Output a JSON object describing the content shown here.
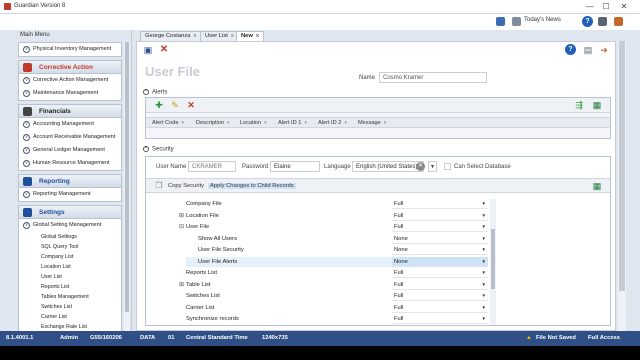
{
  "window": {
    "title": "Guardian Version 8",
    "minimize": "—",
    "maximize": "☐",
    "close": "✕"
  },
  "topbar": {
    "todays_news": "Today's News",
    "help": "?"
  },
  "main_menu": {
    "title": "Main Menu",
    "sections": [
      {
        "label": "",
        "icon": "inventory-icon",
        "items": [
          {
            "label": "Physical Inventory Management"
          }
        ]
      },
      {
        "label": "Corrective Action",
        "color": "#c0392b",
        "icon": "corrective-action-icon",
        "items": [
          {
            "label": "Corrective Action Management"
          },
          {
            "label": "Maintenance Management"
          }
        ]
      },
      {
        "label": "Financials",
        "color": "#222222",
        "icon": "financials-icon",
        "items": [
          {
            "label": "Accounting Management"
          },
          {
            "label": "Account Receivable Management"
          },
          {
            "label": "General Ledger Management"
          },
          {
            "label": "Human Resource Management"
          }
        ]
      },
      {
        "label": "Reporting",
        "color": "#1f4e9c",
        "icon": "reporting-icon",
        "items": [
          {
            "label": "Reporting Management"
          }
        ]
      },
      {
        "label": "Settings",
        "color": "#1f4e9c",
        "icon": "settings-icon",
        "items": [
          {
            "label": "Global Setting Management"
          }
        ],
        "subitems": [
          "Global Settings",
          "SQL Query Tool",
          "Company List",
          "Location List",
          "User List",
          "Reports List",
          "Tables Management",
          "Switches List",
          "Carrier List",
          "Exchange Rate List",
          "Synchronize record"
        ]
      }
    ]
  },
  "tabs": [
    {
      "label": "George Costanza",
      "close": "x"
    },
    {
      "label": "User List",
      "close": "x"
    },
    {
      "label": "New",
      "close": "x",
      "active": true
    }
  ],
  "content": {
    "page_title": "User File",
    "name_label": "Name",
    "name_value": "Cosmo Kramer",
    "alerts": {
      "header": "Alerts",
      "columns": [
        "Alert Code",
        "Description",
        "Location",
        "Alert ID 1",
        "Alert ID 2",
        "Message"
      ]
    },
    "security": {
      "header": "Security",
      "user_name_label": "User Name",
      "user_name_value": "CKRAMER",
      "password_label": "Password",
      "password_value": "Elaine",
      "language_label": "Language",
      "language_value": "English (United States)",
      "can_select_db_label": "Can Select Database",
      "copy_security": "Copy Security",
      "apply_changes": "Apply Changes to Child Records",
      "rows": [
        {
          "name": "Company File",
          "level": 0,
          "expander": "",
          "value": "Full"
        },
        {
          "name": "Location File",
          "level": 0,
          "expander": "⊞",
          "value": "Full"
        },
        {
          "name": "User File",
          "level": 0,
          "expander": "⊟",
          "value": "Full"
        },
        {
          "name": "Show All Users",
          "level": 1,
          "expander": "",
          "value": "None"
        },
        {
          "name": "User File Security",
          "level": 1,
          "expander": "",
          "value": "None"
        },
        {
          "name": "User File Alerts",
          "level": 1,
          "expander": "",
          "value": "None",
          "selected": true
        },
        {
          "name": "Reports List",
          "level": 0,
          "expander": "",
          "value": "Full"
        },
        {
          "name": "Table List",
          "level": 0,
          "expander": "⊞",
          "value": "Full"
        },
        {
          "name": "Switches List",
          "level": 0,
          "expander": "",
          "value": "Full"
        },
        {
          "name": "Carrier List",
          "level": 0,
          "expander": "",
          "value": "Full"
        },
        {
          "name": "Synchronize records",
          "level": 0,
          "expander": "",
          "value": "Full"
        }
      ]
    }
  },
  "statusbar": {
    "version": "8.1.4001.1",
    "user": "Admin",
    "server": "G55/160206",
    "db": "DATA",
    "company": "01",
    "timezone": "Central Standard Time",
    "resolution": "1240x735",
    "file_status": "File Not Saved",
    "access": "Full Access"
  },
  "colors": {
    "accent": "#2f4f86",
    "selection": "#cfe3f7",
    "warning": "#f0c000"
  }
}
